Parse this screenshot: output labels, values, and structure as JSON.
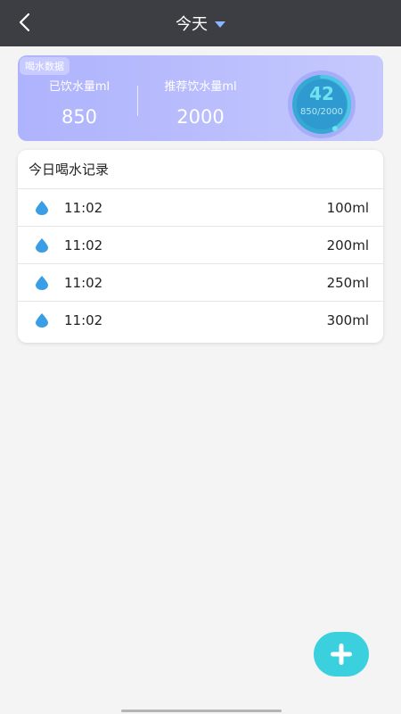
{
  "header": {
    "title": "今天"
  },
  "summary": {
    "tag": "喝水数据",
    "drunk_label": "已饮水量ml",
    "drunk_value": "850",
    "target_label": "推荐饮水量ml",
    "target_value": "2000",
    "percent_text": "42",
    "ratio_text": "850/2000",
    "progress": 0.42
  },
  "records": {
    "title": "今日喝水记录",
    "items": [
      {
        "time": "11:02",
        "amount": "100ml"
      },
      {
        "time": "11:02",
        "amount": "200ml"
      },
      {
        "time": "11:02",
        "amount": "250ml"
      },
      {
        "time": "11:02",
        "amount": "300ml"
      }
    ]
  },
  "colors": {
    "header": "#3d3e43",
    "accent": "#3ad0de",
    "drop": "#3a9ee6",
    "card_gradient_start": "#aeb3fd"
  }
}
